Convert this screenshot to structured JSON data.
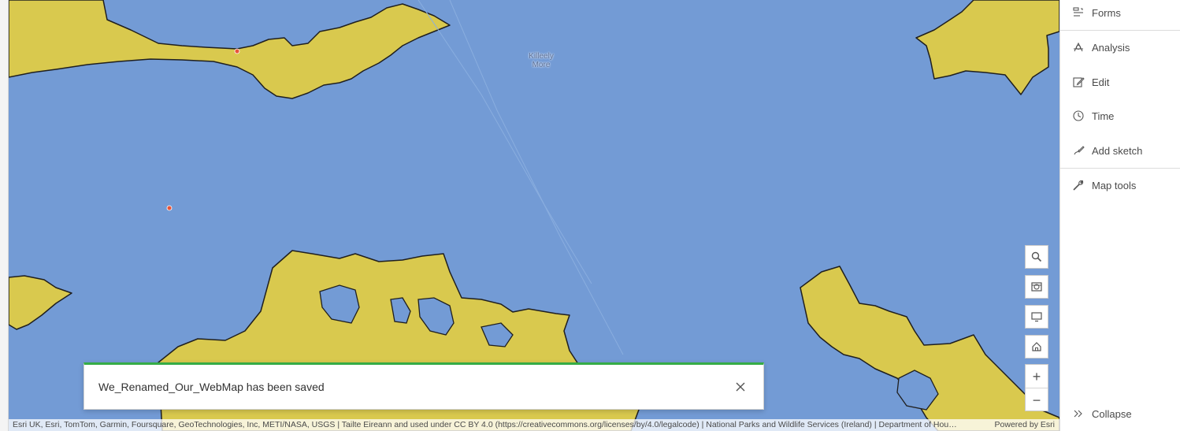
{
  "map": {
    "place_label_line1": "Killeely",
    "place_label_line2": "More",
    "attribution": "Esri UK, Esri, TomTom, Garmin, Foursquare, GeoTechnologies, Inc, METI/NASA, USGS | Tailte Eireann and used under CC BY 4.0 (https://creativecommons.org/licenses/by/4.0/legalcode) | National Parks and Wildlife Services (Ireland) | Department of Hou…",
    "powered_by": "Powered by Esri",
    "colors": {
      "water": "#739bd5",
      "polygon_fill": "#d9c94e",
      "outline": "#1f1f1f",
      "point": "#e8553a"
    }
  },
  "toast": {
    "message": "We_Renamed_Our_WebMap has been saved",
    "accent": "#35ac46"
  },
  "map_controls": {
    "search_icon": "search-icon",
    "basemap_icon": "basemap-gallery-icon",
    "fullscreen_icon": "screen-icon",
    "home_icon": "home-icon",
    "zoom_in": "+",
    "zoom_out": "−"
  },
  "right_panel": {
    "items": [
      {
        "label": "Forms",
        "icon": "forms-icon"
      },
      {
        "label": "Analysis",
        "icon": "analysis-icon"
      },
      {
        "label": "Edit",
        "icon": "edit-icon"
      },
      {
        "label": "Time",
        "icon": "clock-icon"
      },
      {
        "label": "Add sketch",
        "icon": "sketch-icon"
      },
      {
        "label": "Map tools",
        "icon": "wrench-icon"
      }
    ],
    "collapse_label": "Collapse"
  }
}
